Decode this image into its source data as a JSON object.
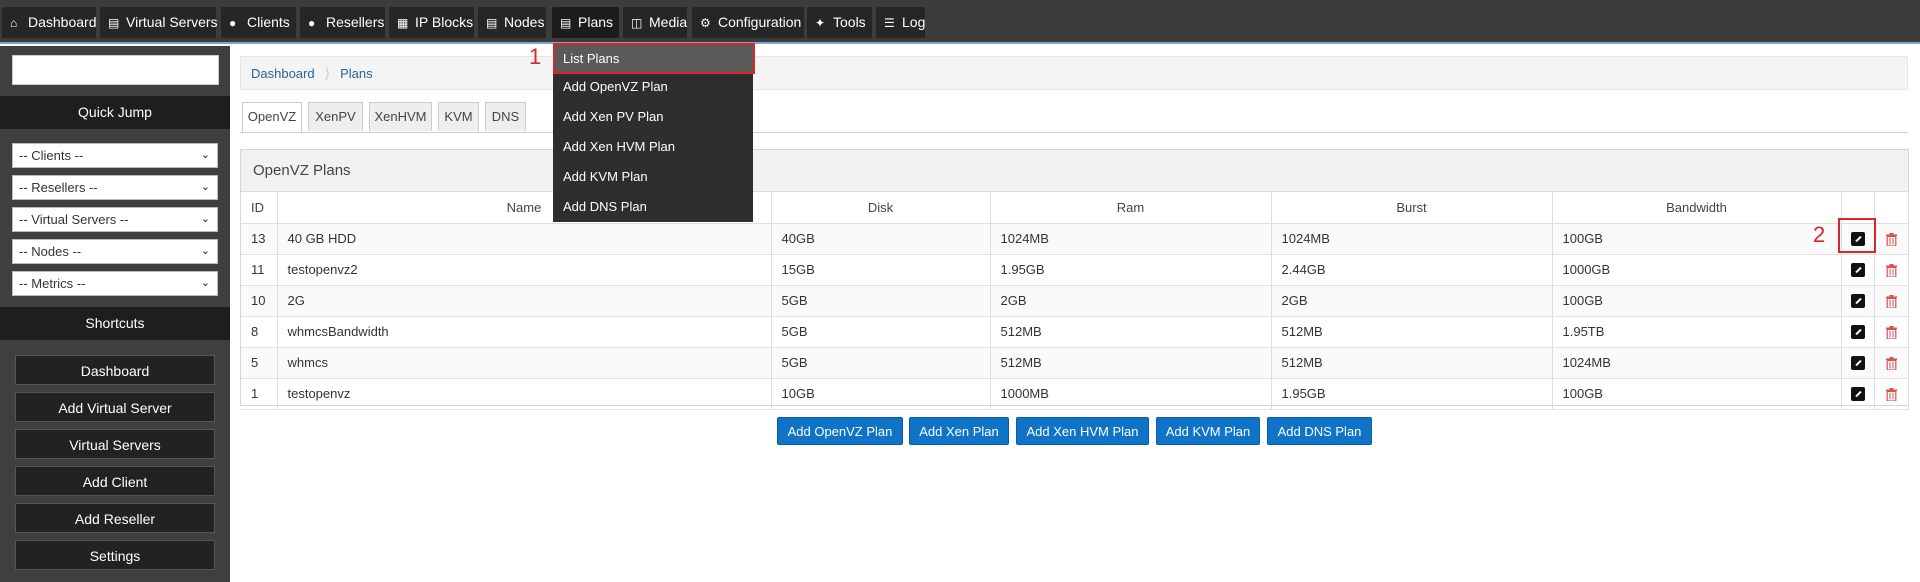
{
  "nav": {
    "items": [
      {
        "label": "Dashboard",
        "icon": "home-icon"
      },
      {
        "label": "Virtual Servers",
        "icon": "server-icon"
      },
      {
        "label": "Clients",
        "icon": "users-icon"
      },
      {
        "label": "Resellers",
        "icon": "user-icon"
      },
      {
        "label": "IP Blocks",
        "icon": "grid-icon"
      },
      {
        "label": "Nodes",
        "icon": "server-icon"
      },
      {
        "label": "Plans",
        "icon": "list-icon"
      },
      {
        "label": "Media",
        "icon": "file-icon"
      },
      {
        "label": "Configuration",
        "icon": "gear-icon"
      },
      {
        "label": "Tools",
        "icon": "wrench-icon"
      },
      {
        "label": "Log",
        "icon": "list-icon"
      }
    ]
  },
  "plans_menu": {
    "items": [
      "List Plans",
      "Add OpenVZ Plan",
      "Add Xen PV Plan",
      "Add Xen HVM Plan",
      "Add KVM Plan",
      "Add DNS Plan"
    ]
  },
  "sidebar": {
    "search_value": "",
    "quick_jump": "Quick Jump",
    "selects": [
      "-- Clients --",
      "-- Resellers --",
      "-- Virtual Servers --",
      "-- Nodes --",
      "-- Metrics --"
    ],
    "shortcuts": "Shortcuts",
    "buttons": [
      "Dashboard",
      "Add Virtual Server",
      "Virtual Servers",
      "Add Client",
      "Add Reseller",
      "Settings"
    ]
  },
  "breadcrumb": {
    "home": "Dashboard",
    "current": "Plans"
  },
  "tabs": [
    "OpenVZ",
    "XenPV",
    "XenHVM",
    "KVM",
    "DNS"
  ],
  "panel": {
    "title": "OpenVZ Plans",
    "columns": [
      "ID",
      "Name",
      "Disk",
      "Ram",
      "Burst",
      "Bandwidth"
    ],
    "rows": [
      [
        "13",
        "40 GB HDD",
        "40GB",
        "1024MB",
        "1024MB",
        "100GB"
      ],
      [
        "11",
        "testopenvz2",
        "15GB",
        "1.95GB",
        "2.44GB",
        "1000GB"
      ],
      [
        "10",
        "2G",
        "5GB",
        "2GB",
        "2GB",
        "100GB"
      ],
      [
        "8",
        "whmcsBandwidth",
        "5GB",
        "512MB",
        "512MB",
        "1.95TB"
      ],
      [
        "5",
        "whmcs",
        "5GB",
        "512MB",
        "512MB",
        "1024MB"
      ],
      [
        "1",
        "testopenvz",
        "10GB",
        "1000MB",
        "1.95GB",
        "100GB"
      ]
    ]
  },
  "bottom_buttons": [
    "Add OpenVZ Plan",
    "Add Xen Plan",
    "Add Xen HVM Plan",
    "Add KVM Plan",
    "Add DNS Plan"
  ],
  "annotations": {
    "one": "1",
    "two": "2"
  },
  "colors": {
    "accent": "#0f74c7",
    "annotation": "#d9262c",
    "nav_bg": "#3c3c3c",
    "delete": "#d9534f"
  }
}
